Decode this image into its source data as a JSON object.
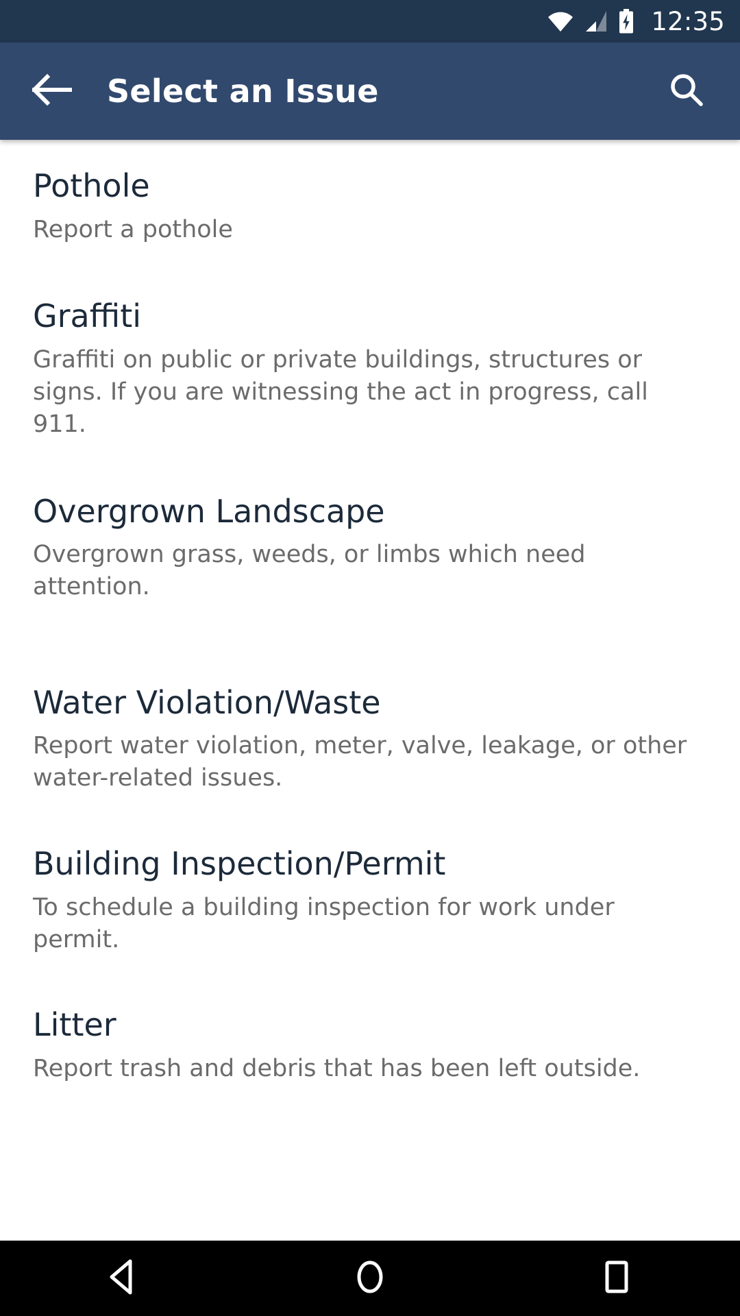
{
  "status_bar": {
    "time": "12:35",
    "icons": [
      "wifi-icon",
      "cell-signal-icon",
      "battery-charging-icon"
    ],
    "background_color": "#21364f",
    "foreground_color": "#ffffff"
  },
  "app_bar": {
    "title": "Select an Issue",
    "back_icon": "back-arrow-icon",
    "search_icon": "search-icon",
    "background_color": "#32496e",
    "foreground_color": "#ffffff"
  },
  "list": {
    "title_color": "#1c2a3a",
    "description_color": "#6b6b6b",
    "items": [
      {
        "title": "Pothole",
        "description": "Report a pothole"
      },
      {
        "title": "Graffiti",
        "description": "Graffiti on public or private buildings, structures or signs. If you are witnessing the act in progress, call 911."
      },
      {
        "title": "Overgrown Landscape",
        "description": "Overgrown grass, weeds, or limbs which need attention."
      },
      {
        "title": "Water Violation/Waste",
        "description": "Report water violation, meter, valve, leakage, or other water-related issues."
      },
      {
        "title": "Building Inspection/Permit",
        "description": "To schedule a building inspection for work under permit."
      },
      {
        "title": "Litter",
        "description": "Report trash and debris that has been left outside."
      }
    ]
  },
  "nav_bar": {
    "background_color": "#000000",
    "buttons": [
      {
        "name": "back",
        "icon": "nav-back-triangle-icon"
      },
      {
        "name": "home",
        "icon": "nav-home-circle-icon"
      },
      {
        "name": "recents",
        "icon": "nav-recents-square-icon"
      }
    ]
  }
}
